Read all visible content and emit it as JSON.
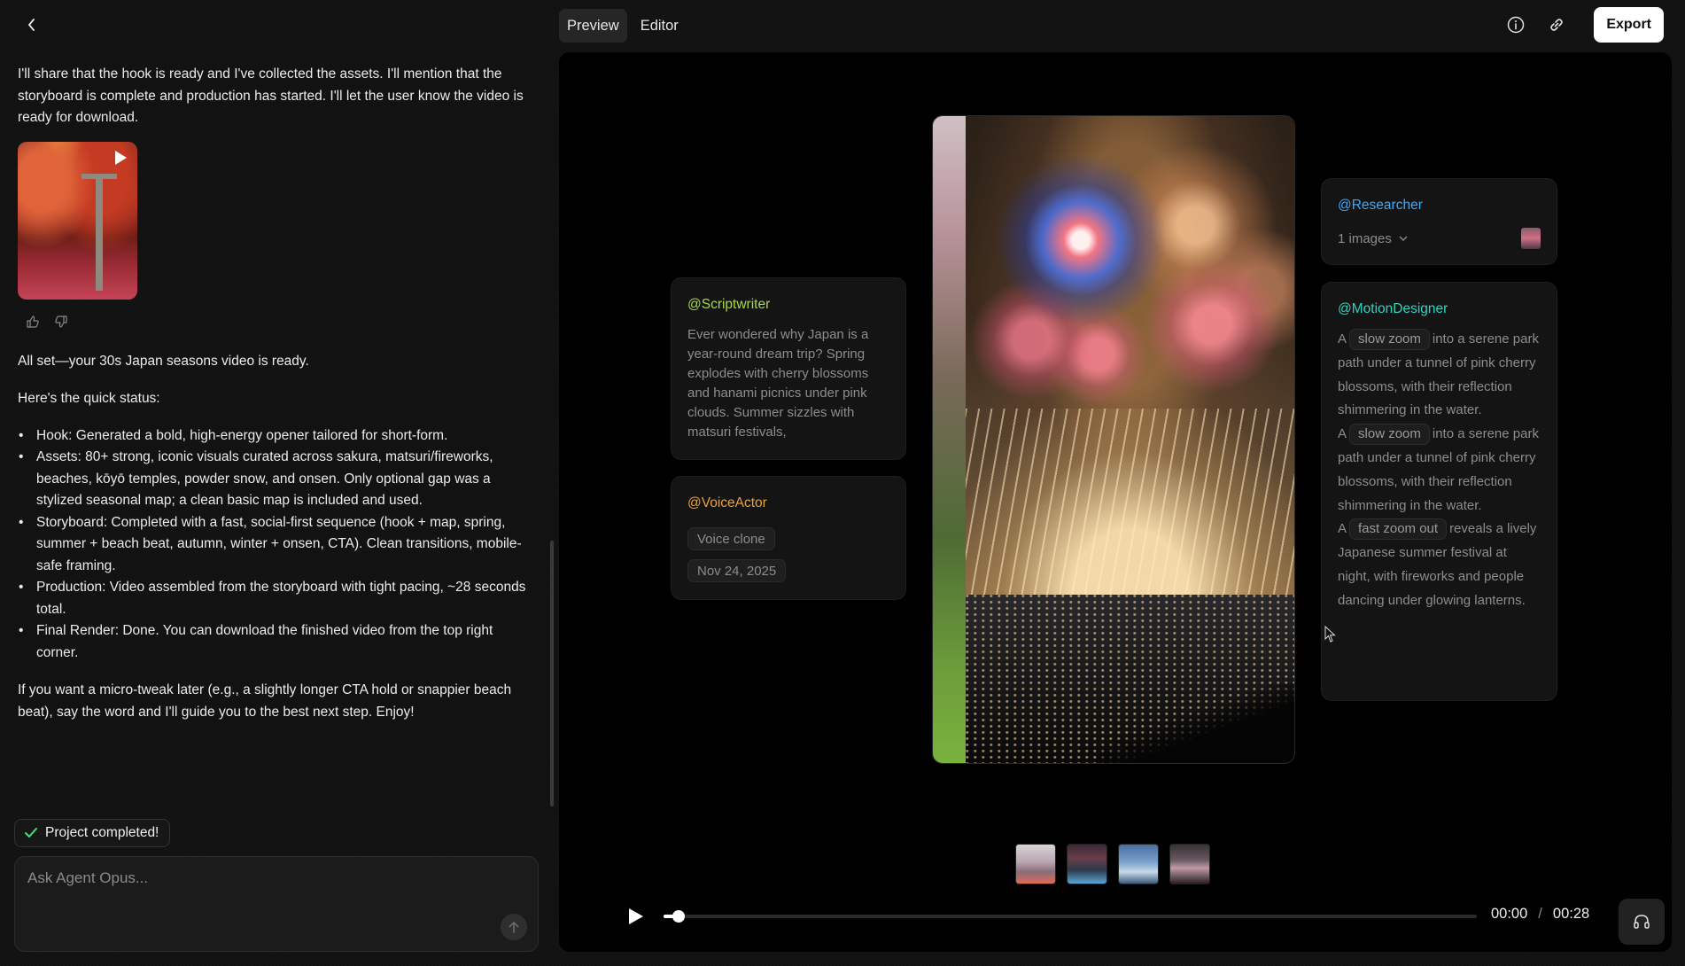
{
  "chat": {
    "intro": "I'll share that the hook is ready and I've collected the assets. I'll mention that the storyboard is complete and production has started. I'll let the user know the video is ready for download.",
    "ready": "All set—your 30s Japan seasons video is ready.",
    "status_heading": "Here's the quick status:",
    "bullets": [
      "Hook: Generated a bold, high-energy opener tailored for short-form.",
      "Assets: 80+ strong, iconic visuals curated across sakura, matsuri/fireworks, beaches, kōyō temples, powder snow, and onsen. Only optional gap was a stylized seasonal map; a clean basic map is included and used.",
      "Storyboard: Completed with a fast, social-first sequence (hook + map, spring, summer + beach beat, autumn, winter + onsen, CTA). Clean transitions, mobile-safe framing.",
      "Production: Video assembled from the storyboard with tight pacing, ~28 seconds total.",
      "Final Render: Done. You can download the finished video from the top right corner."
    ],
    "closing": "If you want a micro-tweak later (e.g., a slightly longer CTA hold or snappier beach beat), say the word and I'll guide you to the best next step. Enjoy!"
  },
  "status_pill": "Project completed!",
  "input": {
    "placeholder": "Ask Agent Opus..."
  },
  "tabs": [
    {
      "label": "Preview"
    },
    {
      "label": "Editor"
    }
  ],
  "export_label": "Export",
  "agents": {
    "scriptwriter": {
      "name": "@Scriptwriter",
      "text": "Ever wondered why Japan is a year-round dream trip? Spring explodes with cherry blossoms and hanami picnics under pink clouds. Summer sizzles with matsuri festivals,"
    },
    "voice": {
      "name": "@VoiceActor",
      "chip1": "Voice clone",
      "chip2": "Nov 24, 2025"
    },
    "researcher": {
      "name": "@Researcher",
      "images_label": "1 images"
    },
    "motion": {
      "name": "@MotionDesigner",
      "lines": [
        {
          "pre": "A",
          "tag": "slow zoom",
          "post": "into a serene park path under a tunnel of pink cherry blossoms, with their reflection shimmering in the water."
        },
        {
          "pre": "A",
          "tag": "slow zoom",
          "post": "into a serene park path under a tunnel of pink cherry blossoms, with their reflection shimmering in the water."
        },
        {
          "pre": "A",
          "tag": "fast zoom out",
          "post": "reveals a lively Japanese summer festival at night, with fireworks and people dancing under glowing lanterns."
        }
      ]
    }
  },
  "player": {
    "current": "00:00",
    "separator": "/",
    "duration": "00:28",
    "progress_fraction": 0.018
  },
  "icons": {
    "back": "chevron-left-icon",
    "info": "info-icon",
    "link": "link-icon",
    "support": "headset-icon",
    "check": "check-icon",
    "send": "arrow-up-icon"
  }
}
